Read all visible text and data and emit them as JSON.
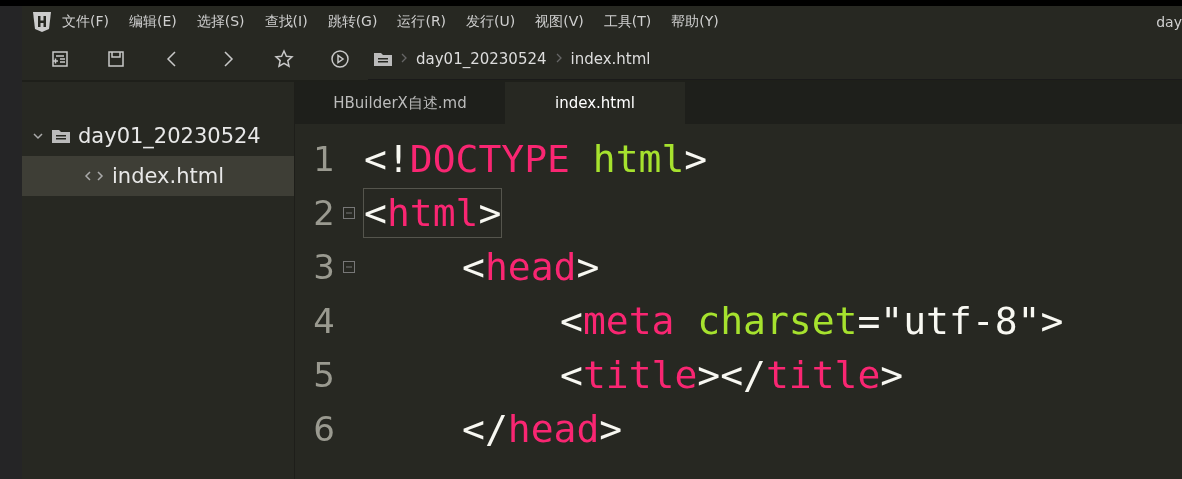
{
  "menu_bar": {
    "items": [
      "文件(F)",
      "编辑(E)",
      "选择(S)",
      "查找(I)",
      "跳转(G)",
      "运行(R)",
      "发行(U)",
      "视图(V)",
      "工具(T)",
      "帮助(Y)"
    ],
    "title": "day"
  },
  "toolbar": {
    "breadcrumb": [
      "day01_20230524",
      "index.html"
    ]
  },
  "tabs": [
    {
      "label": "HBuilderX自述.md",
      "selected": false
    },
    {
      "label": "index.html",
      "selected": true
    }
  ],
  "project_tree": [
    {
      "label": "day01_20230524",
      "expanded": true,
      "children": [
        {
          "label": "index.html",
          "selected": true
        }
      ]
    }
  ],
  "editor": {
    "lines": [
      {
        "number": "1",
        "fold": false,
        "tokens": [
          {
            "kind": "punct",
            "text": "<!"
          },
          {
            "kind": "tag",
            "text": "DOCTYPE"
          },
          {
            "kind": "attr",
            "text": "html"
          },
          {
            "kind": "punct",
            "text": ">"
          }
        ]
      },
      {
        "number": "2",
        "fold": true,
        "boxed": true,
        "tokens": [
          {
            "kind": "punct",
            "text": "<"
          },
          {
            "kind": "tag",
            "text": "html"
          },
          {
            "kind": "punct",
            "text": ">"
          }
        ],
        "children": [
          {
            "number": "3",
            "fold": true,
            "tokens": [
              {
                "kind": "punct",
                "text": "<"
              },
              {
                "kind": "tag",
                "text": "head"
              },
              {
                "kind": "punct",
                "text": ">"
              }
            ],
            "children": [
              {
                "number": "4",
                "fold": false,
                "tokens": [
                  {
                    "kind": "punct",
                    "text": "<"
                  },
                  {
                    "kind": "tag",
                    "text": "meta"
                  },
                  {
                    "kind": "attr",
                    "text": "charset"
                  },
                  {
                    "kind": "punct",
                    "text": "="
                  },
                  {
                    "kind": "string",
                    "text": "\"utf-8\""
                  },
                  {
                    "kind": "punct",
                    "text": ">"
                  }
                ]
              },
              {
                "number": "5",
                "fold": false,
                "tokens": [
                  {
                    "kind": "punct",
                    "text": "<"
                  },
                  {
                    "kind": "tag",
                    "text": "title"
                  },
                  {
                    "kind": "punct",
                    "text": "></"
                  },
                  {
                    "kind": "tag",
                    "text": "title"
                  },
                  {
                    "kind": "punct",
                    "text": ">"
                  }
                ]
              }
            ]
          },
          {
            "number": "6",
            "fold": false,
            "tokens": [
              {
                "kind": "punct",
                "text": "</"
              },
              {
                "kind": "tag",
                "text": "head"
              },
              {
                "kind": "punct",
                "text": ">"
              }
            ]
          }
        ]
      }
    ]
  }
}
